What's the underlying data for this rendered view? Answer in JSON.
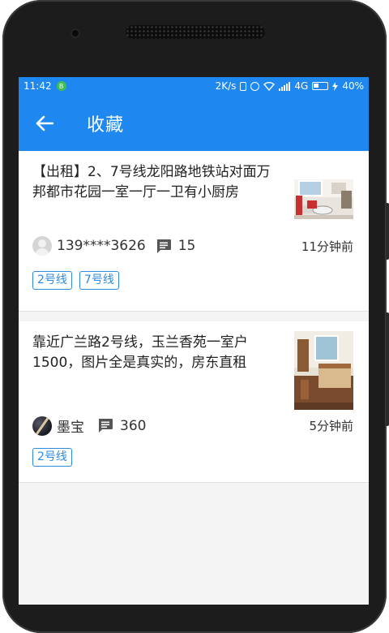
{
  "status_bar": {
    "time": "11:42",
    "app_icon_letter": "B",
    "network_speed": "2K/s",
    "network_type": "4G",
    "battery": "40%"
  },
  "app_bar": {
    "back_icon": "arrow-left-icon",
    "title": "收藏"
  },
  "listings": [
    {
      "title": "【出租】2、7号线龙阳路地铁站对面万邦都市花园一室一厅一卫有小厨房",
      "user": "139****3626",
      "avatar_icon": "default-user-avatar",
      "comments": "15",
      "time_ago": "11分钟前",
      "tags": [
        "2号线",
        "7号线"
      ]
    },
    {
      "title": "靠近广兰路2号线，玉兰香苑一室户1500，图片全是真实的，房东直租",
      "user": "墨宝",
      "avatar_icon": "photo-avatar",
      "comments": "360",
      "time_ago": "5分钟前",
      "tags": [
        "2号线"
      ]
    }
  ],
  "colors": {
    "primary": "#1e88f0",
    "tag": "#2b8be0",
    "background": "#f4f4f4"
  }
}
